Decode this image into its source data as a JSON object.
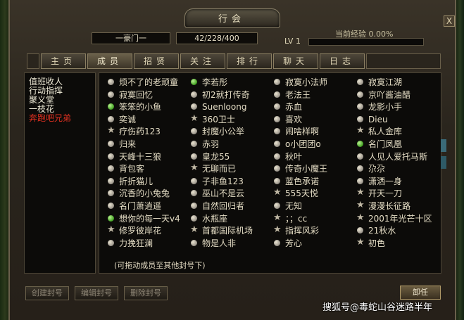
{
  "window": {
    "title": "行会",
    "close_label": "X"
  },
  "header": {
    "guild_name": "一豪门一",
    "member_count": "42/228/400",
    "level": "LV 1",
    "exp_label": "当前经验 0.00%",
    "exp_progress": 0
  },
  "tabs": [
    {
      "label": "主页",
      "active": false
    },
    {
      "label": "成员",
      "active": true
    },
    {
      "label": "招贤",
      "active": false
    },
    {
      "label": "关注",
      "active": false
    },
    {
      "label": "排行",
      "active": false
    },
    {
      "label": "聊天",
      "active": false
    },
    {
      "label": "日志",
      "active": false
    }
  ],
  "ranks": [
    {
      "label": "值班收人",
      "color": "#f0ecd8"
    },
    {
      "label": "行动指挥",
      "color": "#f0ecd8"
    },
    {
      "label": "聚义堂",
      "color": "#f0ecd8"
    },
    {
      "label": "一枝花",
      "color": "#f0ecd8"
    },
    {
      "label": "奔跑吧兄弟",
      "color": "#e03020"
    }
  ],
  "columns": [
    [
      {
        "name": "烦不了的老顽童",
        "status": "gray"
      },
      {
        "name": "寂寞回忆",
        "status": "gray"
      },
      {
        "name": "笨笨的小鱼",
        "status": "green"
      },
      {
        "name": "奕诚",
        "status": "gray"
      },
      {
        "name": "疗伤药123",
        "status": "star"
      },
      {
        "name": "归来",
        "status": "gray"
      },
      {
        "name": "天峰十三狼",
        "status": "gray"
      },
      {
        "name": "背包客",
        "status": "gray"
      },
      {
        "name": "折折猫儿",
        "status": "gray"
      },
      {
        "name": "沉香的小兔兔",
        "status": "gray"
      },
      {
        "name": "名门萧逍遥",
        "status": "gray"
      },
      {
        "name": "想你的每一天v4",
        "status": "green"
      },
      {
        "name": "修罗彼岸花",
        "status": "star"
      },
      {
        "name": "力挽狂澜",
        "status": "gray"
      }
    ],
    [
      {
        "name": "李若彤",
        "status": "green"
      },
      {
        "name": "初2就打传奇",
        "status": "gray"
      },
      {
        "name": "Suenloong",
        "status": "gray"
      },
      {
        "name": "360卫士",
        "status": "star"
      },
      {
        "name": "封魔小公举",
        "status": "gray"
      },
      {
        "name": "赤羽",
        "status": "gray"
      },
      {
        "name": "皇龙55",
        "status": "gray"
      },
      {
        "name": "无聊而已",
        "status": "star"
      },
      {
        "name": "子非鱼123",
        "status": "gray"
      },
      {
        "name": "巫山不是云",
        "status": "gray"
      },
      {
        "name": "自然回归者",
        "status": "gray"
      },
      {
        "name": "水瓶座",
        "status": "gray"
      },
      {
        "name": "首都国际机场",
        "status": "star"
      },
      {
        "name": "物是人非",
        "status": "gray"
      }
    ],
    [
      {
        "name": "寂寞小法师",
        "status": "gray"
      },
      {
        "name": "老法王",
        "status": "gray"
      },
      {
        "name": "赤血",
        "status": "gray"
      },
      {
        "name": "喜欢",
        "status": "gray"
      },
      {
        "name": "闹啥样啊",
        "status": "gray"
      },
      {
        "name": "o小团团o",
        "status": "gray"
      },
      {
        "name": "秋叶",
        "status": "gray"
      },
      {
        "name": "传奇小魔王",
        "status": "gray"
      },
      {
        "name": "蓝色承诺",
        "status": "gray"
      },
      {
        "name": "555天悦",
        "status": "star"
      },
      {
        "name": "无知",
        "status": "gray"
      },
      {
        "name": "；；cc",
        "status": "star"
      },
      {
        "name": "指挥风彩",
        "status": "star"
      },
      {
        "name": "芳心",
        "status": "gray"
      }
    ],
    [
      {
        "name": "寂寞江湖",
        "status": "gray"
      },
      {
        "name": "京吖酱油醋",
        "status": "gray"
      },
      {
        "name": "龙影小手",
        "status": "gray"
      },
      {
        "name": "Dieu",
        "status": "gray"
      },
      {
        "name": "私人金库",
        "status": "star"
      },
      {
        "name": "名门凤凰",
        "status": "green"
      },
      {
        "name": "人见人爱托马斯",
        "status": "gray"
      },
      {
        "name": "尕尕",
        "status": "gray"
      },
      {
        "name": "潇洒一身",
        "status": "gray"
      },
      {
        "name": "开天一刀",
        "status": "star"
      },
      {
        "name": "漫漫长征路",
        "status": "star"
      },
      {
        "name": "2001年光芒十区",
        "status": "star"
      },
      {
        "name": "21秋水",
        "status": "gray"
      },
      {
        "name": "初色",
        "status": "star"
      }
    ]
  ],
  "hint": "(可拖动成员至其他封号下)",
  "buttons": {
    "create_title": "创建封号",
    "edit_title": "编辑封号",
    "delete_title": "删除封号",
    "dismiss": "卸任"
  },
  "watermark": "搜狐号@毒蛇山谷迷路半年"
}
